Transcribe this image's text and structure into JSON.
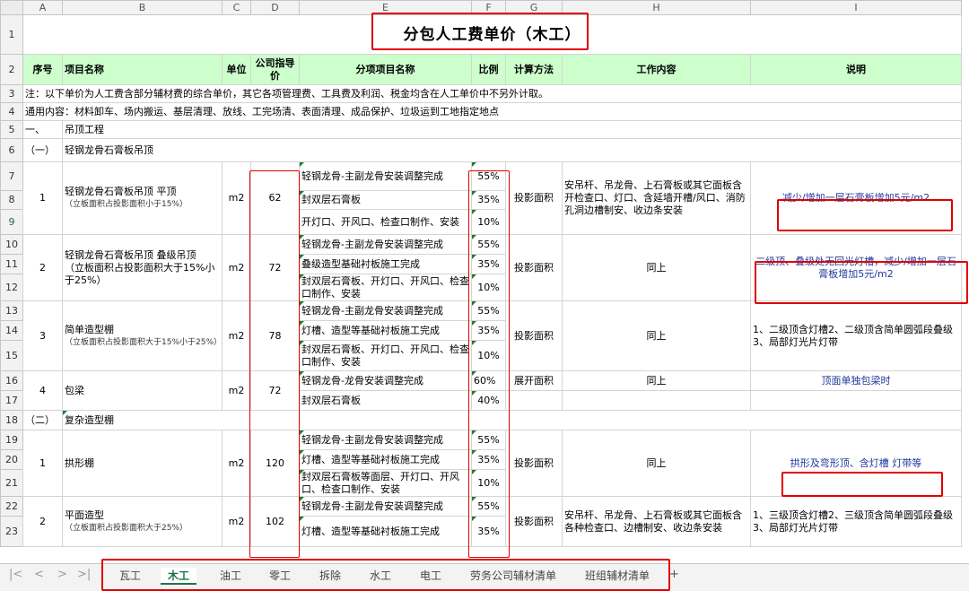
{
  "columns": [
    "A",
    "B",
    "C",
    "D",
    "E",
    "F",
    "G",
    "H",
    "I"
  ],
  "title": "分包人工费单价（木工）",
  "headers": {
    "seq": "序号",
    "item": "项目名称",
    "unit": "单位",
    "price": "公司指导价",
    "sub": "分项项目名称",
    "ratio": "比例",
    "calc": "计算方法",
    "work": "工作内容",
    "note": "说明"
  },
  "note_row": "注：以下单价为人工费含部分辅材费的综合单价，其它各项管理费、工具费及利润、税金均含在人工单价中不另外计取。",
  "general_row": "通用内容：材料卸车、场内搬运、基层清理、放线、工完场清、表面清理、成品保护、垃圾运到工地指定地点",
  "sec1_no": "一、",
  "sec1_name": "吊顶工程",
  "sub1_no": "（一）",
  "sub1_name": "轻钢龙骨石膏板吊顶",
  "sub2_no": "（二）",
  "sub2_name": "复杂造型棚",
  "items": [
    {
      "seq": "1",
      "name": "轻钢龙骨石膏板吊顶 平顶",
      "sub": "（立板面积占投影面积小于15%）",
      "unit": "m2",
      "price": "62",
      "calc": "投影面积",
      "work": "安吊杆、吊龙骨、上石膏板或其它面板含开检查口、灯口、含延墙开槽/风口、消防孔洞边槽制安、收边条安装",
      "note": "减少/增加一层石膏板增加5元/m2",
      "parts": [
        {
          "name": "轻钢龙骨-主副龙骨安装调整完成",
          "ratio": "55%"
        },
        {
          "name": "封双层石膏板",
          "ratio": "35%"
        },
        {
          "name": "开灯口、开风口、检查口制作、安装",
          "ratio": "10%"
        }
      ]
    },
    {
      "seq": "2",
      "name": "轻钢龙骨石膏板吊顶 叠级吊顶",
      "sub": "（立板面积占投影面积大于15%小于25%）",
      "unit": "m2",
      "price": "72",
      "calc": "投影面积",
      "work": "同上",
      "note": "二级顶、叠级处无回光灯槽，减少/增加一层石膏板增加5元/m2",
      "parts": [
        {
          "name": "轻钢龙骨-主副龙骨安装调整完成",
          "ratio": "55%"
        },
        {
          "name": "叠级造型基础衬板施工完成",
          "ratio": "35%"
        },
        {
          "name": "封双层石膏板、开灯口、开风口、检查口制作、安装",
          "ratio": "10%"
        }
      ]
    },
    {
      "seq": "3",
      "name": "简单造型棚",
      "sub": "（立板面积占投影面积大于15%小于25%）",
      "unit": "m2",
      "price": "78",
      "calc": "投影面积",
      "work": "同上",
      "note": "1、二级顶含灯槽2、二级顶含简单圆弧段叠级 3、局部灯光片灯带",
      "parts": [
        {
          "name": "轻钢龙骨-主副龙骨安装调整完成",
          "ratio": "55%"
        },
        {
          "name": "灯槽、造型等基础衬板施工完成",
          "ratio": "35%"
        },
        {
          "name": "封双层石膏板、开灯口、开风口、检查口制作、安装",
          "ratio": "10%"
        }
      ]
    },
    {
      "seq": "4",
      "name": "包梁",
      "unit": "m2",
      "price": "72",
      "calc": "展开面积",
      "work": "同上",
      "note": "顶面单独包梁时",
      "parts": [
        {
          "name": "轻钢龙骨-龙骨安装调整完成",
          "ratio": "60%"
        },
        {
          "name": "封双层石膏板",
          "ratio": "40%"
        }
      ]
    },
    {
      "seq": "1",
      "name": "拱形棚",
      "unit": "m2",
      "price": "120",
      "calc": "投影面积",
      "work": "同上",
      "note": "拱形及弯形顶、含灯槽 灯带等",
      "parts": [
        {
          "name": "轻钢龙骨-主副龙骨安装调整完成",
          "ratio": "55%"
        },
        {
          "name": "灯槽、造型等基础衬板施工完成",
          "ratio": "35%"
        },
        {
          "name": "封双层石膏板等面层、开灯口、开风口、检查口制作、安装",
          "ratio": "10%"
        }
      ]
    },
    {
      "seq": "2",
      "name": "平面造型",
      "sub": "（立板面积占投影面积大于25%）",
      "unit": "m2",
      "price": "102",
      "calc": "投影面积",
      "work": "安吊杆、吊龙骨、上石膏板或其它面板含各种检查口、边槽制安、收边条安装",
      "note": "1、三级顶含灯槽2、三级顶含简单圆弧段叠级 3、局部灯光片灯带",
      "parts": [
        {
          "name": "轻钢龙骨-主副龙骨安装调整完成",
          "ratio": "55%"
        },
        {
          "name": "灯槽、造型等基础衬板施工完成",
          "ratio": "35%"
        }
      ]
    }
  ],
  "sheet_tabs": [
    "瓦工",
    "木工",
    "油工",
    "零工",
    "拆除",
    "水工",
    "电工",
    "劳务公司辅材清单",
    "班组辅材清单"
  ],
  "active_tab": "木工",
  "nav": {
    "first": "|<",
    "prev": "<",
    "next": ">",
    "last": ">|",
    "add": "+"
  },
  "colors": {
    "header_fill": "#ccffcc",
    "highlight": "#e00000",
    "link_text": "#1f3a9a",
    "active_tab": "#217346"
  }
}
